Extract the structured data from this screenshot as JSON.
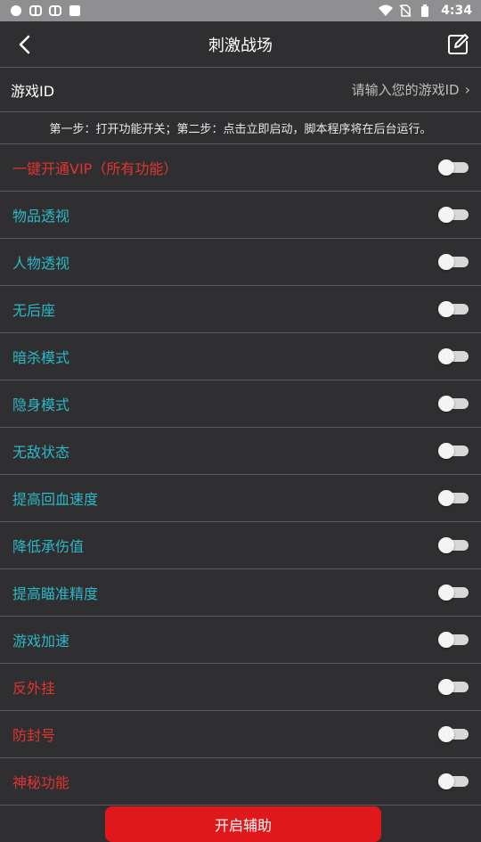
{
  "statusbar": {
    "time": "4:34",
    "icons_left": [
      "circle-icon",
      "bug-icon",
      "bug-icon",
      "square-icon"
    ],
    "icons_right": [
      "wifi-icon",
      "no-sim-icon",
      "battery-icon"
    ]
  },
  "header": {
    "title": "刺激战场"
  },
  "game_id": {
    "label": "游戏ID",
    "placeholder": "请输入您的游戏ID"
  },
  "hint": "第一步：打开功能开关；第二步：点击立即启动，脚本程序将在后台运行。",
  "items": [
    {
      "label": "一键开通VIP（所有功能）",
      "color": "red",
      "on": false
    },
    {
      "label": "物品透视",
      "color": "teal",
      "on": false
    },
    {
      "label": "人物透视",
      "color": "teal",
      "on": false
    },
    {
      "label": "无后座",
      "color": "teal",
      "on": false
    },
    {
      "label": "暗杀模式",
      "color": "teal",
      "on": false
    },
    {
      "label": "隐身模式",
      "color": "teal",
      "on": false
    },
    {
      "label": "无敌状态",
      "color": "teal",
      "on": false
    },
    {
      "label": "提高回血速度",
      "color": "teal",
      "on": false
    },
    {
      "label": "降低承伤值",
      "color": "teal",
      "on": false
    },
    {
      "label": "提高瞄准精度",
      "color": "teal",
      "on": false
    },
    {
      "label": "游戏加速",
      "color": "teal",
      "on": false
    },
    {
      "label": "反外挂",
      "color": "red",
      "on": false
    },
    {
      "label": "防封号",
      "color": "red",
      "on": false
    },
    {
      "label": "神秘功能",
      "color": "red",
      "on": false
    }
  ],
  "start_button": "开启辅助",
  "colors": {
    "accent_red": "#e0181c",
    "teal": "#2cb8c6",
    "background": "#2f2f31"
  }
}
